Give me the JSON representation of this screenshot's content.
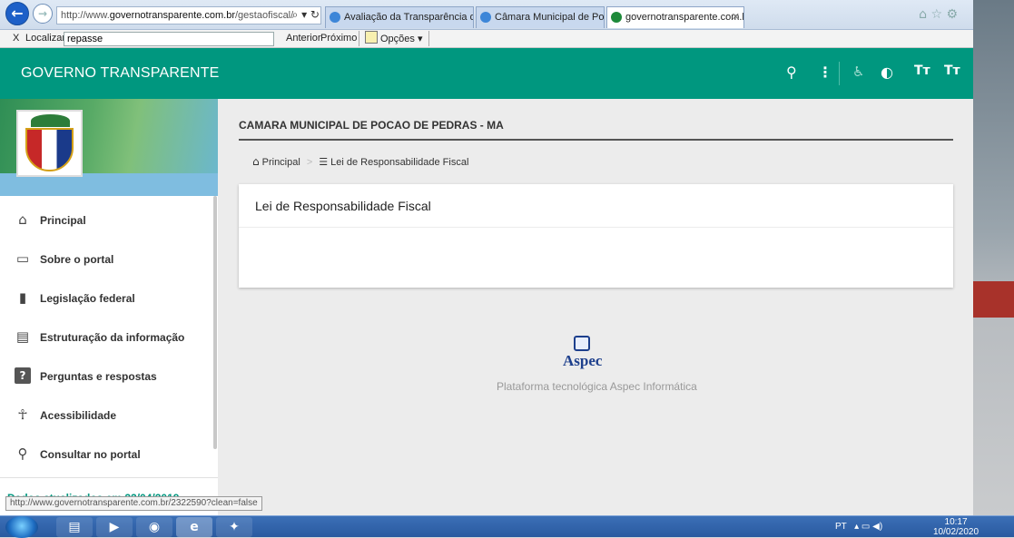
{
  "browser": {
    "url_prefix": "http://www.",
    "url_domain": "governotransparente.com.br",
    "url_path": "/gestaofiscal/",
    "addr_tools": "⌕ ▾ ↻",
    "tabs": [
      {
        "label": "Avaliação da Transparência do..."
      },
      {
        "label": "Câmara Municipal de Poção d..."
      },
      {
        "label": "governotransparente.com.br",
        "close": "✕"
      }
    ],
    "win_icons": "⌂ ☆ ⚙",
    "find": {
      "close": "X",
      "label": "Localizar:",
      "value": "repasse",
      "prev": "Anterior",
      "next": "Próximo",
      "options": "Opções ▾"
    },
    "status_url": "http://www.governotransparente.com.br/2322590?clean=false"
  },
  "header": {
    "brand": "GOVERNO TRANSPARENTE",
    "icons": {
      "search": "⚲",
      "more": "⋮",
      "accessibility": "♿",
      "contrast": "◐",
      "font_up": "Tт",
      "font_down": "Tт"
    }
  },
  "sidebar": {
    "items": [
      {
        "label": "Principal",
        "icon": "home-icon",
        "glyph": "⌂"
      },
      {
        "label": "Sobre o portal",
        "icon": "folder-icon",
        "glyph": "▭"
      },
      {
        "label": "Legislação federal",
        "icon": "document-icon",
        "glyph": "▮"
      },
      {
        "label": "Estruturação da informação",
        "icon": "list-icon",
        "glyph": "▤"
      },
      {
        "label": "Perguntas e respostas",
        "icon": "help-icon",
        "glyph": "?"
      },
      {
        "label": "Acessibilidade",
        "icon": "accessibility-icon",
        "glyph": "☥"
      },
      {
        "label": "Consultar no portal",
        "icon": "search-icon",
        "glyph": "⚲"
      }
    ],
    "updated": "Dados atualizados em 22/04/2019"
  },
  "content": {
    "council": "CAMARA MUNICIPAL DE POCAO DE PEDRAS - MA",
    "breadcrumb": {
      "home": "Principal",
      "separator": ">",
      "current": "Lei de Responsabilidade Fiscal"
    },
    "card_title": "Lei de Responsabilidade Fiscal"
  },
  "footer": {
    "logo_text": "Aspec",
    "platform": "Plataforma tecnológica Aspec Informática"
  },
  "taskbar": {
    "tray_lang": "PT",
    "tray_icons": "▴ ▭ ◀)",
    "time": "10:17",
    "date": "10/02/2020"
  },
  "colors": {
    "brand_teal": "#00977f",
    "page_bg": "#ececec"
  }
}
